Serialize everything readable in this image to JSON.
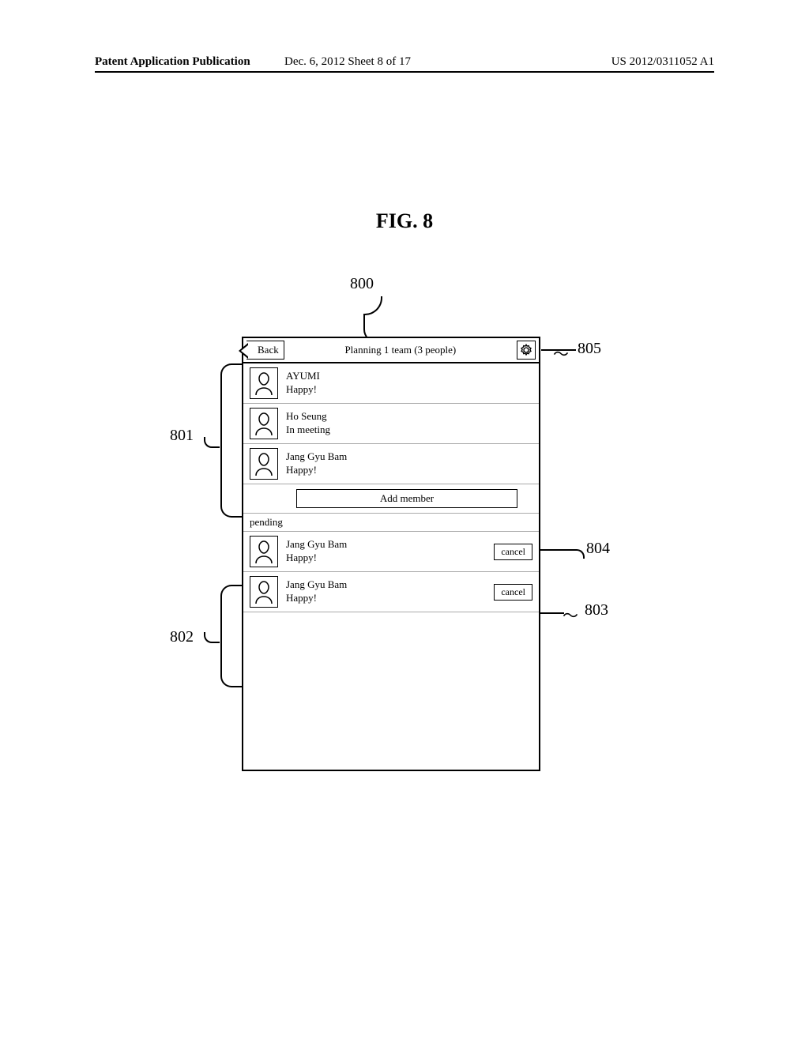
{
  "header": {
    "left": "Patent Application Publication",
    "center": "Dec. 6, 2012   Sheet 8 of 17",
    "right": "US 2012/0311052 A1"
  },
  "figure_label": "FIG. 8",
  "callouts": {
    "screen": "800",
    "gear": "805",
    "add_member": "804",
    "cancel": "803",
    "members_group": "801",
    "pending_group": "802"
  },
  "screen": {
    "back_label": "Back",
    "title": "Planning 1 team (3 people)",
    "members": [
      {
        "name": "AYUMI",
        "status": "Happy!"
      },
      {
        "name": "Ho Seung",
        "status": "In meeting"
      },
      {
        "name": "Jang Gyu Bam",
        "status": "Happy!"
      }
    ],
    "add_member_label": "Add member",
    "pending_label": "pending",
    "pending": [
      {
        "name": "Jang Gyu Bam",
        "status": "Happy!",
        "cancel": "cancel"
      },
      {
        "name": "Jang Gyu Bam",
        "status": "Happy!",
        "cancel": "cancel"
      }
    ]
  }
}
